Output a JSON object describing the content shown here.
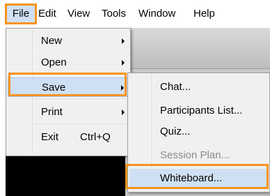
{
  "menubar": {
    "items": [
      "File",
      "Edit",
      "View",
      "Tools",
      "Window",
      "Help"
    ]
  },
  "file_menu": {
    "items": [
      {
        "label": "New",
        "has_submenu": true
      },
      {
        "label": "Open",
        "has_submenu": true
      },
      {
        "label": "Save",
        "has_submenu": true,
        "state": "highlighted"
      },
      {
        "label": "Print",
        "has_submenu": true
      },
      {
        "label": "Exit",
        "shortcut": "Ctrl+Q"
      }
    ]
  },
  "save_submenu": {
    "items": [
      {
        "label": "Chat..."
      },
      {
        "label": "Participants List..."
      },
      {
        "label": "Quiz..."
      },
      {
        "label": "Session Plan...",
        "state": "disabled"
      },
      {
        "label": "Whiteboard...",
        "state": "highlighted"
      }
    ]
  },
  "colors": {
    "callout_outline": "#f7941d",
    "selection_fill": "#cfe0f3",
    "menu_background": "#f0f0f0",
    "disabled_text": "#8a8a8a"
  }
}
